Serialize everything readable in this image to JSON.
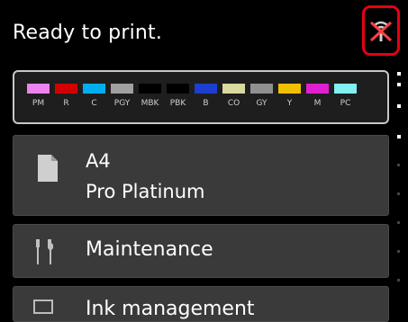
{
  "header": {
    "status": "Ready to print.",
    "wifi_icon": "wireless-disconnected-icon",
    "highlight_color": "#e60012"
  },
  "ink_panel": {
    "inks": [
      {
        "label": "PM",
        "color": "#ee82ee"
      },
      {
        "label": "R",
        "color": "#d40000"
      },
      {
        "label": "C",
        "color": "#00aeef"
      },
      {
        "label": "PGY",
        "color": "#a0a0a0"
      },
      {
        "label": "MBK",
        "color": "#000000"
      },
      {
        "label": "PBK",
        "color": "#000000"
      },
      {
        "label": "B",
        "color": "#1c3fd0"
      },
      {
        "label": "CO",
        "color": "#d8d8a0"
      },
      {
        "label": "GY",
        "color": "#909090"
      },
      {
        "label": "Y",
        "color": "#f0c000"
      },
      {
        "label": "M",
        "color": "#e020d0"
      },
      {
        "label": "PC",
        "color": "#80f0f0"
      }
    ]
  },
  "menu": {
    "paper": {
      "size": "A4",
      "type": "Pro Platinum",
      "icon": "paper-sheet-icon"
    },
    "maintenance": {
      "label": "Maintenance",
      "icon": "maintenance-tools-icon"
    },
    "ink_management": {
      "label": "Ink management",
      "icon": "ink-management-icon"
    }
  }
}
